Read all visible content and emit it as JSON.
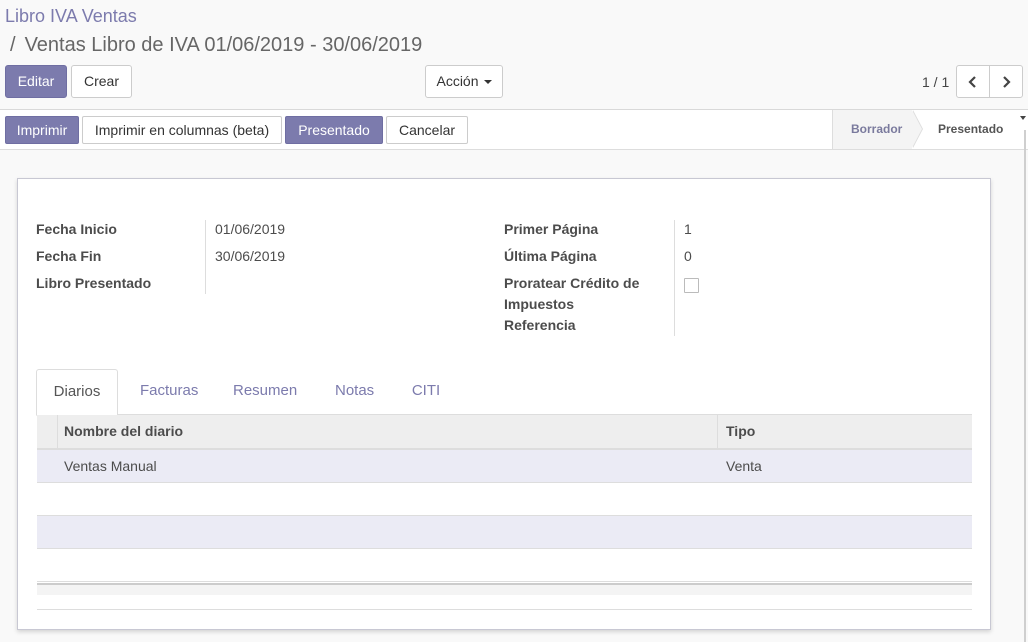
{
  "breadcrumb": {
    "parent": "Libro IVA Ventas",
    "separator": "/",
    "current": "Ventas Libro de IVA 01/06/2019 - 30/06/2019"
  },
  "toolbar": {
    "edit_label": "Editar",
    "create_label": "Crear",
    "action_label": "Acción"
  },
  "pager": {
    "value": "1 / 1"
  },
  "statusbar": {
    "buttons": [
      "Imprimir",
      "Imprimir en columnas (beta)",
      "Presentado",
      "Cancelar"
    ],
    "stages": [
      "Borrador",
      "Presentado"
    ],
    "current_stage": "Presentado"
  },
  "form": {
    "left_fields": [
      {
        "label": "Fecha Inicio",
        "value": "01/06/2019"
      },
      {
        "label": "Fecha Fin",
        "value": "30/06/2019"
      },
      {
        "label": "Libro Presentado",
        "value": ""
      }
    ],
    "right_fields": [
      {
        "label": "Primer Página",
        "value": "1"
      },
      {
        "label": "Última Página",
        "value": "0"
      },
      {
        "label": "Proratear Crédito de Impuestos",
        "value": ""
      },
      {
        "label": "Referencia",
        "value": ""
      }
    ],
    "proratear_checked": false
  },
  "tabs": [
    "Diarios",
    "Facturas",
    "Resumen",
    "Notas",
    "CITI"
  ],
  "active_tab": "Diarios",
  "journal_table": {
    "columns": [
      "Nombre del diario",
      "Tipo"
    ],
    "rows": [
      {
        "name": "Ventas Manual",
        "type": "Venta"
      }
    ]
  },
  "colors": {
    "primary": "#7c7bad",
    "row_highlight": "#ebebf5"
  }
}
